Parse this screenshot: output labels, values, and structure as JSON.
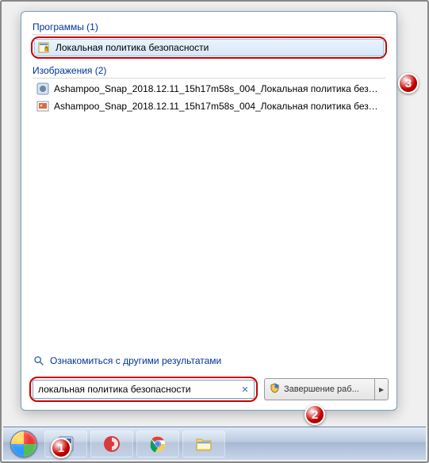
{
  "groups": {
    "programs": {
      "header": "Программы (1)"
    },
    "images": {
      "header": "Изображения (2)"
    }
  },
  "results": {
    "program1": {
      "label": "Локальная политика безопасности",
      "icon": "security-policy-icon"
    },
    "image1": {
      "label": "Ashampoo_Snap_2018.12.11_15h17m58s_004_Локальная политика безопас..",
      "icon": "image-file-icon"
    },
    "image2": {
      "label": "Ashampoo_Snap_2018.12.11_15h17m58s_004_Локальная политика безопас..",
      "icon": "image-file-icon"
    }
  },
  "more_results_label": "Ознакомиться с другими результатами",
  "search": {
    "value": "локальная политика безопасности",
    "placeholder": ""
  },
  "shutdown": {
    "label": "Завершение раб..."
  },
  "annotations": {
    "b1": "1",
    "b2": "2",
    "b3": "3"
  }
}
